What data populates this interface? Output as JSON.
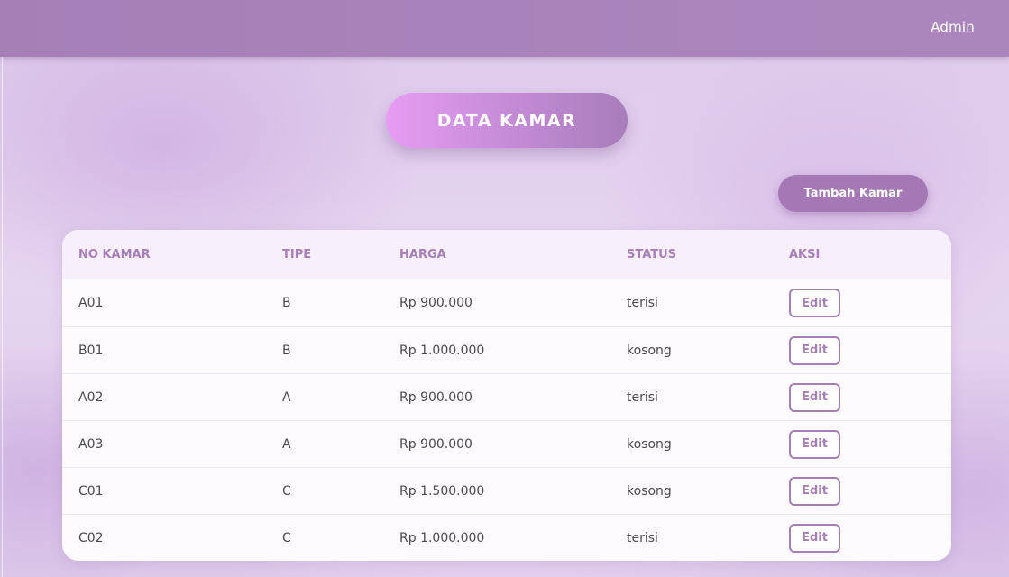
{
  "navbar": {
    "user_label": "Admin"
  },
  "page": {
    "title": "DATA KAMAR",
    "add_button_label": "Tambah Kamar"
  },
  "table": {
    "headers": [
      "NO KAMAR",
      "TIPE",
      "HARGA",
      "STATUS",
      "AKSI"
    ],
    "action_label": "Edit",
    "rows": [
      {
        "no_kamar": "A01",
        "tipe": "B",
        "harga": "Rp 900.000",
        "status": "terisi"
      },
      {
        "no_kamar": "B01",
        "tipe": "B",
        "harga": "Rp 1.000.000",
        "status": "kosong"
      },
      {
        "no_kamar": "A02",
        "tipe": "A",
        "harga": "Rp 900.000",
        "status": "terisi"
      },
      {
        "no_kamar": "A03",
        "tipe": "A",
        "harga": "Rp 900.000",
        "status": "kosong"
      },
      {
        "no_kamar": "C01",
        "tipe": "C",
        "harga": "Rp 1.500.000",
        "status": "kosong"
      },
      {
        "no_kamar": "C02",
        "tipe": "C",
        "harga": "Rp 1.000.000",
        "status": "terisi"
      }
    ]
  },
  "colors": {
    "accent": "#a67fb7",
    "navbar": "#a67fb7",
    "title_gradient_start": "#e79cf3",
    "title_gradient_end": "#a87dbb"
  }
}
